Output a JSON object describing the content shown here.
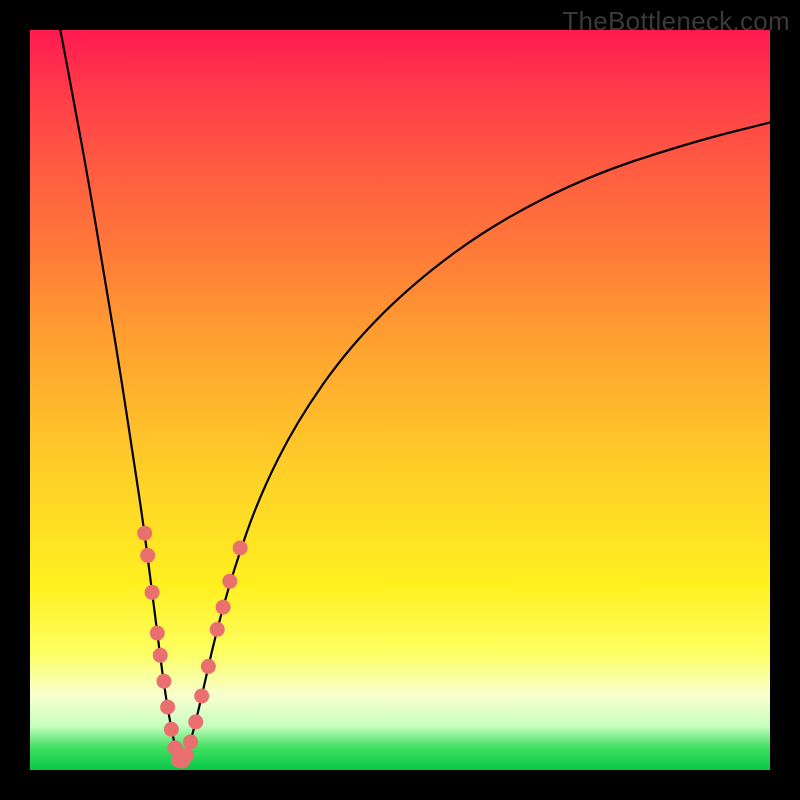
{
  "watermark": "TheBottleneck.com",
  "colors": {
    "background_frame": "#000000",
    "gradient_top": "#ff1a4f",
    "gradient_bottom": "#08c848",
    "curve": "#000000",
    "dots": "#e9706f"
  },
  "chart_data": {
    "type": "line",
    "title": "",
    "xlabel": "",
    "ylabel": "",
    "xlim": [
      0,
      100
    ],
    "ylim": [
      0,
      100
    ],
    "grid": false,
    "legend": false,
    "dip_x": 20.3,
    "series": [
      {
        "name": "left-branch",
        "points": [
          {
            "x": 4.1,
            "y": 100.0
          },
          {
            "x": 6.0,
            "y": 90.0
          },
          {
            "x": 8.0,
            "y": 79.0
          },
          {
            "x": 10.0,
            "y": 67.0
          },
          {
            "x": 12.0,
            "y": 55.0
          },
          {
            "x": 14.0,
            "y": 42.0
          },
          {
            "x": 15.5,
            "y": 32.0
          },
          {
            "x": 17.0,
            "y": 20.0
          },
          {
            "x": 18.3,
            "y": 10.0
          },
          {
            "x": 19.5,
            "y": 3.5
          },
          {
            "x": 20.3,
            "y": 0.8
          }
        ]
      },
      {
        "name": "right-branch",
        "points": [
          {
            "x": 20.3,
            "y": 0.8
          },
          {
            "x": 21.5,
            "y": 3.0
          },
          {
            "x": 23.0,
            "y": 9.0
          },
          {
            "x": 25.0,
            "y": 18.0
          },
          {
            "x": 27.5,
            "y": 27.0
          },
          {
            "x": 31.0,
            "y": 37.0
          },
          {
            "x": 36.0,
            "y": 47.0
          },
          {
            "x": 43.0,
            "y": 57.0
          },
          {
            "x": 52.0,
            "y": 66.0
          },
          {
            "x": 63.0,
            "y": 74.0
          },
          {
            "x": 76.0,
            "y": 80.5
          },
          {
            "x": 90.0,
            "y": 85.0
          },
          {
            "x": 100.0,
            "y": 87.5
          }
        ]
      }
    ],
    "highlight_points": [
      {
        "x": 15.5,
        "y": 32.0
      },
      {
        "x": 15.9,
        "y": 29.0
      },
      {
        "x": 16.5,
        "y": 24.0
      },
      {
        "x": 17.2,
        "y": 18.5
      },
      {
        "x": 17.6,
        "y": 15.5
      },
      {
        "x": 18.1,
        "y": 12.0
      },
      {
        "x": 18.6,
        "y": 8.5
      },
      {
        "x": 19.1,
        "y": 5.5
      },
      {
        "x": 19.6,
        "y": 3.0
      },
      {
        "x": 20.1,
        "y": 1.3
      },
      {
        "x": 20.6,
        "y": 1.2
      },
      {
        "x": 21.1,
        "y": 2.0
      },
      {
        "x": 21.7,
        "y": 3.8
      },
      {
        "x": 22.4,
        "y": 6.5
      },
      {
        "x": 23.2,
        "y": 10.0
      },
      {
        "x": 24.1,
        "y": 14.0
      },
      {
        "x": 25.3,
        "y": 19.0
      },
      {
        "x": 26.1,
        "y": 22.0
      },
      {
        "x": 27.0,
        "y": 25.5
      },
      {
        "x": 28.4,
        "y": 30.0
      }
    ]
  }
}
